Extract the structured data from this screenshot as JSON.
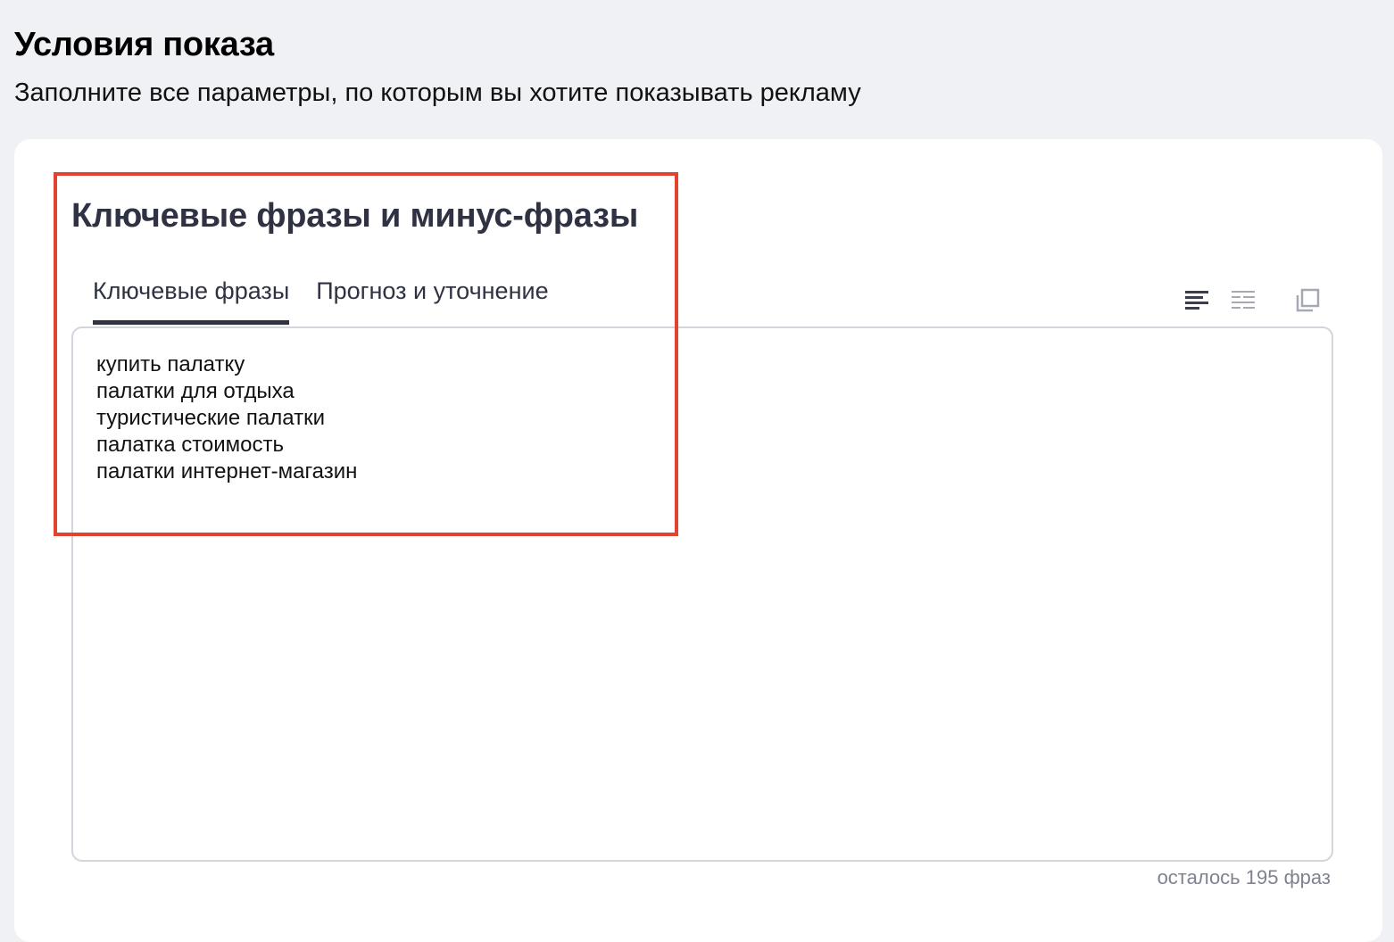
{
  "header": {
    "title": "Условия показа",
    "subtitle": "Заполните все параметры, по которым вы хотите показывать рекламу"
  },
  "section": {
    "title": "Ключевые фразы и минус-фразы",
    "tabs": [
      {
        "label": "Ключевые фразы",
        "active": true
      },
      {
        "label": "Прогноз и уточнение",
        "active": false
      }
    ]
  },
  "toolbar": {
    "icons": [
      "align-left-icon",
      "list-view-icon",
      "copy-icon"
    ]
  },
  "editor": {
    "phrases": [
      "купить палатку",
      "палатки для отдыха",
      "туристические палатки",
      "палатка стоимость",
      "палатки интернет-магазин"
    ],
    "counter": "осталось 195 фраз"
  },
  "colors": {
    "page_bg": "#f0f1f5",
    "card_bg": "#ffffff",
    "text_dark": "#2f3242",
    "highlight": "#e2432f",
    "muted": "#80838f"
  }
}
